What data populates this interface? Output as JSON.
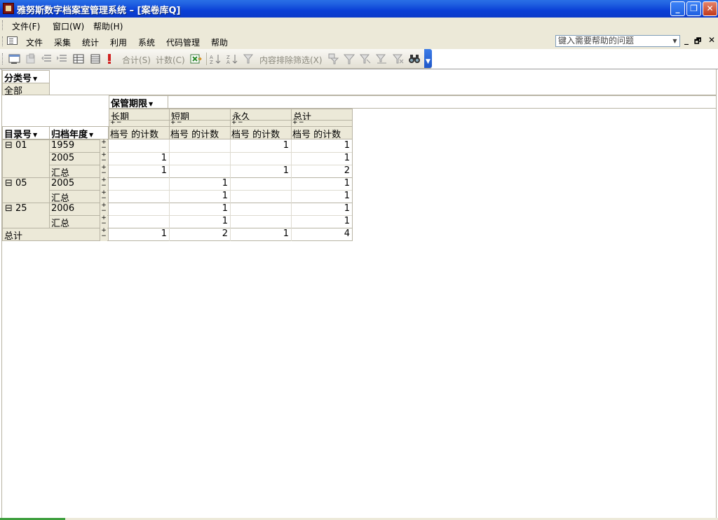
{
  "window": {
    "title": "雅努斯数字档案室管理系统 – [案卷库Q]",
    "minimize": "_",
    "restore": "❐",
    "close": "✕"
  },
  "menubar": {
    "items": [
      "文件(F)",
      "窗口(W)",
      "帮助(H)"
    ]
  },
  "menubar2": {
    "items": [
      "文件",
      "采集",
      "统计",
      "利用",
      "系统",
      "代码管理",
      "帮助"
    ],
    "help_placeholder": "键入需要帮助的问题",
    "mdi_min": "_",
    "mdi_restore": "🗗",
    "mdi_close": "✕"
  },
  "toolbar": {
    "sum_label": "合计(S)",
    "count_label": "计数(C)",
    "filter_label": "内容排除筛选(X)"
  },
  "pivot": {
    "filter_field": "分类号",
    "filter_value": "全部",
    "column_field": "保管期限",
    "column_items": [
      "长期",
      "短期",
      "永久",
      "总计"
    ],
    "measure_label": "档号  的计数",
    "row_fields": [
      "目录号",
      "归档年度"
    ],
    "rows": [
      {
        "catalog": "⊟ 01",
        "year": "1959",
        "values": [
          "",
          "",
          "1",
          "1"
        ]
      },
      {
        "catalog": "",
        "year": "2005",
        "values": [
          "1",
          "",
          "",
          "1"
        ]
      },
      {
        "catalog": "",
        "year": "汇总",
        "values": [
          "1",
          "",
          "1",
          "2"
        ]
      },
      {
        "catalog": "⊟ 05",
        "year": "2005",
        "values": [
          "",
          "1",
          "",
          "1"
        ]
      },
      {
        "catalog": "",
        "year": "汇总",
        "values": [
          "",
          "1",
          "",
          "1"
        ]
      },
      {
        "catalog": "⊟ 25",
        "year": "2006",
        "values": [
          "",
          "1",
          "",
          "1"
        ]
      },
      {
        "catalog": "",
        "year": "汇总",
        "values": [
          "",
          "1",
          "",
          "1"
        ]
      }
    ],
    "grand_total_label": "总计",
    "grand_total": [
      "1",
      "2",
      "1",
      "4"
    ]
  }
}
